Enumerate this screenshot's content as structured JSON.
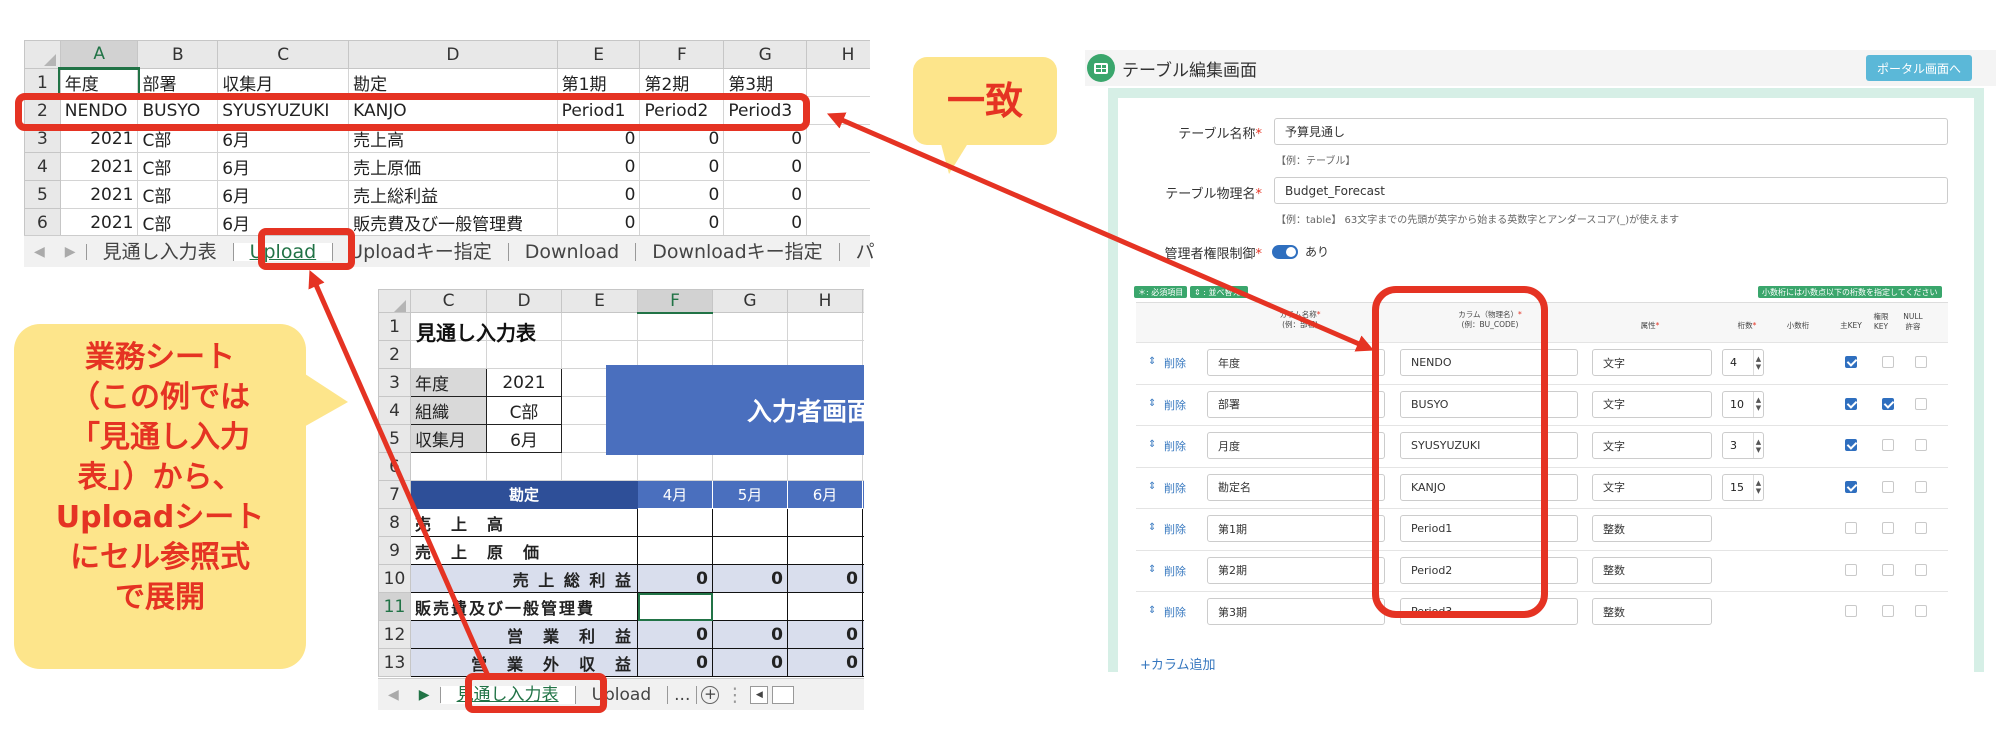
{
  "top_sheet": {
    "col_headers": [
      "A",
      "B",
      "C",
      "D",
      "E",
      "F",
      "G",
      "H"
    ],
    "rows": [
      {
        "n": "1",
        "cells": [
          "年度",
          "部署",
          "収集月",
          "勘定",
          "第1期",
          "第2期",
          "第3期",
          ""
        ]
      },
      {
        "n": "2",
        "cells": [
          "NENDO",
          "BUSYO",
          "SYUSYUZUKI",
          "KANJO",
          "Period1",
          "Period2",
          "Period3",
          ""
        ]
      },
      {
        "n": "3",
        "cells": [
          "2021",
          "C部",
          "6月",
          "売上高",
          "0",
          "0",
          "0",
          ""
        ]
      },
      {
        "n": "4",
        "cells": [
          "2021",
          "C部",
          "6月",
          "売上原価",
          "0",
          "0",
          "0",
          ""
        ]
      },
      {
        "n": "5",
        "cells": [
          "2021",
          "C部",
          "6月",
          "売上総利益",
          "0",
          "0",
          "0",
          ""
        ]
      },
      {
        "n": "6",
        "cells": [
          "2021",
          "C部",
          "6月",
          "販売費及び一般管理費",
          "0",
          "0",
          "0",
          ""
        ]
      }
    ],
    "tabs": [
      "見通し入力表",
      "Upload",
      "Uploadキー指定",
      "Download",
      "Downloadキー指定",
      "パ"
    ]
  },
  "bottom_sheet": {
    "col_headers": [
      "C",
      "D",
      "E",
      "F",
      "G",
      "H"
    ],
    "row_numbers": [
      "1",
      "2",
      "3",
      "4",
      "5",
      "6",
      "7",
      "8",
      "9",
      "10",
      "11",
      "12",
      "13"
    ],
    "title": "見通し入力表",
    "info": [
      {
        "label": "年度",
        "value": "2021"
      },
      {
        "label": "組織",
        "value": "C部"
      },
      {
        "label": "収集月",
        "value": "6月"
      }
    ],
    "banner": "入力者画面",
    "header": {
      "account": "勘定",
      "months": [
        "4月",
        "5月",
        "6月"
      ]
    },
    "accounts": [
      {
        "name": "売　上　高",
        "vals": [
          "",
          "",
          ""
        ]
      },
      {
        "name": "売　上　原　価",
        "vals": [
          "",
          "",
          ""
        ]
      },
      {
        "name": "売 上 総 利 益",
        "vals": [
          "0",
          "0",
          "0"
        ]
      },
      {
        "name": "販売費及び一般管理費",
        "vals": [
          "",
          "",
          ""
        ]
      },
      {
        "name": "営　業　利　益",
        "vals": [
          "0",
          "0",
          "0"
        ]
      },
      {
        "name": "営　業　外　収　益",
        "vals": [
          "0",
          "0",
          "0"
        ]
      }
    ],
    "tabs": [
      "見通し入力表",
      "Upload",
      "..."
    ]
  },
  "callouts": {
    "match": "一致",
    "desc": [
      "業務シート",
      "（この例では",
      "「見通し入力",
      "表」）から、",
      "Uploadシート",
      "にセル参照式",
      "で展開"
    ]
  },
  "app": {
    "title": "テーブル編集画面",
    "portal_button": "ポータル画面へ",
    "table_name_label": "テーブル名称",
    "table_name_value": "予算見通し",
    "table_name_hint": "【例：テーブル】",
    "physical_label": "テーブル物理名",
    "physical_value": "Budget_Forecast",
    "physical_hint": "【例：table】 63文字までの先頭が英字から始まる英数字とアンダースコア(_)が使えます",
    "admin_label": "管理者権限制御",
    "admin_value": "あり",
    "badge_required": "＊: 必須項目",
    "badge_move": "⇕ : 並べ替え",
    "decimal_note": "小数桁には小数点以下の桁数を指定してください",
    "col_name_header": "カラム名称",
    "col_name_example": "(例：部署)",
    "col_code_header": "カラム（物理名）",
    "col_code_example": "(例：BU_CODE)",
    "attr_header": "属性",
    "digits_header": "桁数",
    "decimal_header": "小数桁",
    "key_header": "主KEY",
    "perm_key_header": "権限KEY",
    "null_header": "NULL許容",
    "delete_label": "削除",
    "add_column": "+カラム追加",
    "columns": [
      {
        "name": "年度",
        "code": "NENDO",
        "attr": "文字",
        "digits": "4",
        "key": true,
        "perm": false
      },
      {
        "name": "部署",
        "code": "BUSYO",
        "attr": "文字",
        "digits": "10",
        "key": true,
        "perm": true
      },
      {
        "name": "月度",
        "code": "SYUSYUZUKI",
        "attr": "文字",
        "digits": "3",
        "key": true,
        "perm": false
      },
      {
        "name": "勘定名",
        "code": "KANJO",
        "attr": "文字",
        "digits": "15",
        "key": true,
        "perm": false
      },
      {
        "name": "第1期",
        "code": "Period1",
        "attr": "整数",
        "digits": "",
        "key": false,
        "perm": false
      },
      {
        "name": "第2期",
        "code": "Period2",
        "attr": "整数",
        "digits": "",
        "key": false,
        "perm": false
      },
      {
        "name": "第3期",
        "code": "Period3",
        "attr": "整数",
        "digits": "",
        "key": false,
        "perm": false
      }
    ]
  },
  "colors": {
    "accent_red": "#e53323",
    "callout_yellow": "#fde58b",
    "excel_green": "#217346",
    "banner_blue": "#4a6fbe",
    "header_navy": "#2e4f98",
    "app_teal": "#3aa66c"
  }
}
